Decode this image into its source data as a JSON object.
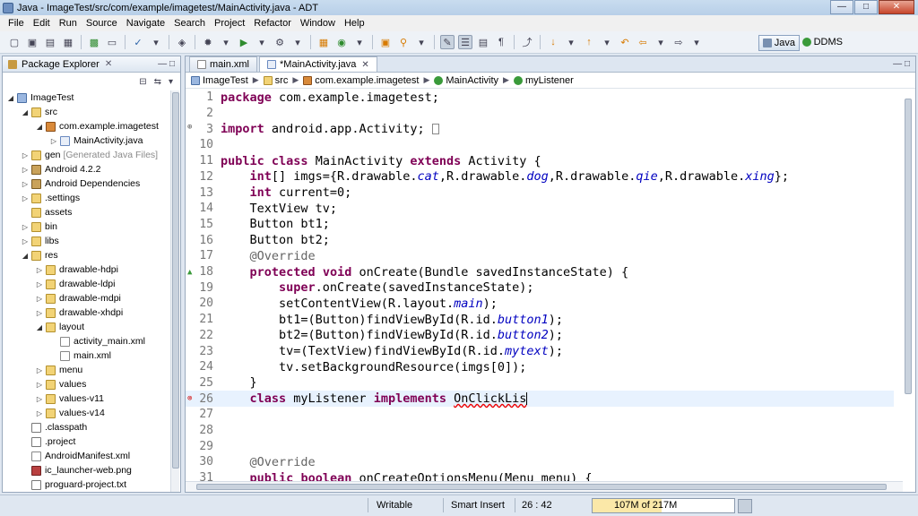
{
  "window": {
    "title": "Java - ImageTest/src/com/example/imagetest/MainActivity.java - ADT"
  },
  "menu": [
    "File",
    "Edit",
    "Run",
    "Source",
    "Navigate",
    "Search",
    "Project",
    "Refactor",
    "Window",
    "Help"
  ],
  "perspectives": {
    "java": "Java",
    "ddms": "DDMS"
  },
  "package_explorer": {
    "tab_label": "Package Explorer",
    "items": [
      {
        "label": "ImageTest",
        "extra": ""
      },
      {
        "label": "src",
        "extra": ""
      },
      {
        "label": "com.example.imagetest",
        "extra": ""
      },
      {
        "label": "MainActivity.java",
        "extra": ""
      },
      {
        "label": "gen",
        "extra": "[Generated Java Files]"
      },
      {
        "label": "Android 4.2.2",
        "extra": ""
      },
      {
        "label": "Android Dependencies",
        "extra": ""
      },
      {
        "label": ".settings",
        "extra": ""
      },
      {
        "label": "assets",
        "extra": ""
      },
      {
        "label": "bin",
        "extra": ""
      },
      {
        "label": "libs",
        "extra": ""
      },
      {
        "label": "res",
        "extra": ""
      },
      {
        "label": "drawable-hdpi",
        "extra": ""
      },
      {
        "label": "drawable-ldpi",
        "extra": ""
      },
      {
        "label": "drawable-mdpi",
        "extra": ""
      },
      {
        "label": "drawable-xhdpi",
        "extra": ""
      },
      {
        "label": "layout",
        "extra": ""
      },
      {
        "label": "activity_main.xml",
        "extra": ""
      },
      {
        "label": "main.xml",
        "extra": ""
      },
      {
        "label": "menu",
        "extra": ""
      },
      {
        "label": "values",
        "extra": ""
      },
      {
        "label": "values-v11",
        "extra": ""
      },
      {
        "label": "values-v14",
        "extra": ""
      },
      {
        "label": ".classpath",
        "extra": ""
      },
      {
        "label": ".project",
        "extra": ""
      },
      {
        "label": "AndroidManifest.xml",
        "extra": ""
      },
      {
        "label": "ic_launcher-web.png",
        "extra": ""
      },
      {
        "label": "proguard-project.txt",
        "extra": ""
      }
    ]
  },
  "editor": {
    "tabs": [
      {
        "label": "main.xml",
        "active": false
      },
      {
        "label": "*MainActivity.java",
        "active": true
      }
    ],
    "breadcrumb": [
      "ImageTest",
      "src",
      "com.example.imagetest",
      "MainActivity",
      "myListener"
    ],
    "lines": [
      {
        "num": "1",
        "code": "package com.example.imagetest;"
      },
      {
        "num": "2",
        "code": ""
      },
      {
        "num": "3",
        "code": "import android.app.Activity;"
      },
      {
        "num": "10",
        "code": ""
      },
      {
        "num": "11",
        "code": "public class MainActivity extends Activity {"
      },
      {
        "num": "12",
        "code": "    int[] imgs={R.drawable.cat,R.drawable.dog,R.drawable.qie,R.drawable.xing};"
      },
      {
        "num": "13",
        "code": "    int current=0;"
      },
      {
        "num": "14",
        "code": "    TextView tv;"
      },
      {
        "num": "15",
        "code": "    Button bt1;"
      },
      {
        "num": "16",
        "code": "    Button bt2;"
      },
      {
        "num": "17",
        "code": "    @Override"
      },
      {
        "num": "18",
        "code": "    protected void onCreate(Bundle savedInstanceState) {"
      },
      {
        "num": "19",
        "code": "        super.onCreate(savedInstanceState);"
      },
      {
        "num": "20",
        "code": "        setContentView(R.layout.main);"
      },
      {
        "num": "21",
        "code": "        bt1=(Button)findViewById(R.id.button1);"
      },
      {
        "num": "22",
        "code": "        bt2=(Button)findViewById(R.id.button2);"
      },
      {
        "num": "23",
        "code": "        tv=(TextView)findViewById(R.id.mytext);"
      },
      {
        "num": "24",
        "code": "        tv.setBackgroundResource(imgs[0]);"
      },
      {
        "num": "25",
        "code": "    }"
      },
      {
        "num": "26",
        "code": "    class myListener implements OnClickLis"
      },
      {
        "num": "27",
        "code": ""
      },
      {
        "num": "28",
        "code": ""
      },
      {
        "num": "29",
        "code": ""
      },
      {
        "num": "30",
        "code": "    @Override"
      },
      {
        "num": "31",
        "code": "    public boolean onCreateOptionsMenu(Menu menu) {"
      }
    ]
  },
  "status": {
    "writable": "Writable",
    "insert_mode": "Smart Insert",
    "position": "26 : 42",
    "heap": "107M of 217M",
    "heap_used_fraction": 0.49
  }
}
